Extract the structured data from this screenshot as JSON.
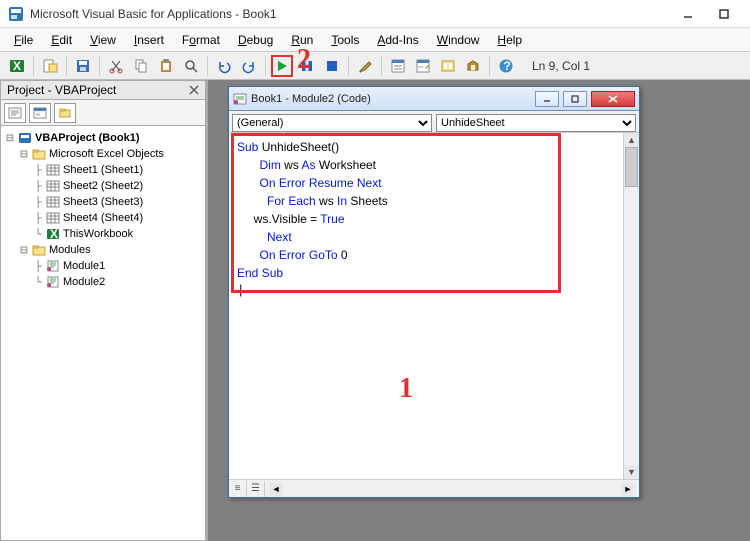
{
  "app": {
    "title": "Microsoft Visual Basic for Applications - Book1"
  },
  "menubar": [
    "File",
    "Edit",
    "View",
    "Insert",
    "Format",
    "Debug",
    "Run",
    "Tools",
    "Add-Ins",
    "Window",
    "Help"
  ],
  "status": {
    "cursor": "Ln 9, Col 1"
  },
  "project_panel": {
    "title": "Project - VBAProject"
  },
  "tree": {
    "root": "VBAProject (Book1)",
    "excel_folder": "Microsoft Excel Objects",
    "sheets": [
      "Sheet1 (Sheet1)",
      "Sheet2 (Sheet2)",
      "Sheet3 (Sheet3)",
      "Sheet4 (Sheet4)"
    ],
    "workbook": "ThisWorkbook",
    "modules_folder": "Modules",
    "modules": [
      "Module1",
      "Module2"
    ]
  },
  "codewin": {
    "title": "Book1 - Module2 (Code)",
    "left_dd": "(General)",
    "right_dd": "UnhideSheet"
  },
  "code": {
    "l1a": "Sub",
    "l1b": " UnhideSheet()",
    "l2a": "Dim",
    "l2b": " ws ",
    "l2c": "As",
    "l2d": " Worksheet",
    "l3": "On Error Resume Next",
    "l4a": "For Each",
    "l4b": " ws ",
    "l4c": "In",
    "l4d": " Sheets",
    "l5a": "     ws.Visible = ",
    "l5b": "True",
    "l6": "Next",
    "l7": "On Error GoTo",
    "l7b": " 0",
    "l8": "End Sub"
  },
  "callouts": {
    "one": "1",
    "two": "2"
  }
}
